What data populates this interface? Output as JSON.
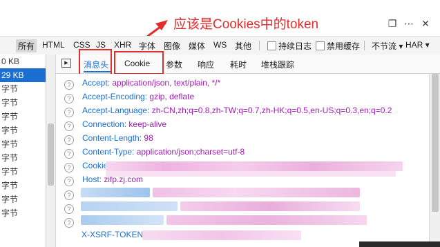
{
  "annotation": {
    "text": "应该是Cookies中的token",
    "color": "#e32c2c"
  },
  "filters": {
    "items": [
      "所有",
      "HTML",
      "CSS",
      "JS",
      "XHR",
      "字体",
      "图像",
      "媒体",
      "WS",
      "其他"
    ],
    "active": "所有",
    "persist_log": "持续日志",
    "disable_cache": "禁用缓存",
    "throttle": "不节流 ▾",
    "har": "HAR ▾"
  },
  "request_list": {
    "rows": [
      "0 KB",
      "29 KB",
      "字节",
      "字节",
      "字节",
      "字节",
      "字节",
      "字节",
      "字节",
      "字节",
      "字节",
      "字节"
    ],
    "selected_index": 1
  },
  "tabs": {
    "items": [
      "消息头",
      "Cookie",
      "参数",
      "响应",
      "耗时",
      "堆栈跟踪"
    ],
    "active": "消息头"
  },
  "headers": [
    {
      "key": "Accept:",
      "value": "application/json, text/plain, */*"
    },
    {
      "key": "Accept-Encoding:",
      "value": "gzip, deflate"
    },
    {
      "key": "Accept-Language:",
      "value": "zh-CN,zh;q=0.8,zh-TW;q=0.7,zh-HK;q=0.5,en-US;q=0.3,en;q=0.2"
    },
    {
      "key": "Connection:",
      "value": "keep-alive"
    },
    {
      "key": "Content-Length:",
      "value": "98"
    },
    {
      "key": "Content-Type:",
      "value": "application/json;charset=utf-8"
    },
    {
      "key": "Cookie",
      "value": ""
    },
    {
      "key": "Host:",
      "value": "zifp.zj.com"
    },
    {
      "key": "",
      "value": ""
    },
    {
      "key": "",
      "value": ""
    },
    {
      "key": "",
      "value": ""
    },
    {
      "key": "X-XSRF-TOKEN:",
      "value": ""
    }
  ],
  "colors": {
    "accent": "#1a6fd1",
    "value": "#a11ab5",
    "highlight": "#e32c2c"
  },
  "icons": {
    "question": "?"
  }
}
